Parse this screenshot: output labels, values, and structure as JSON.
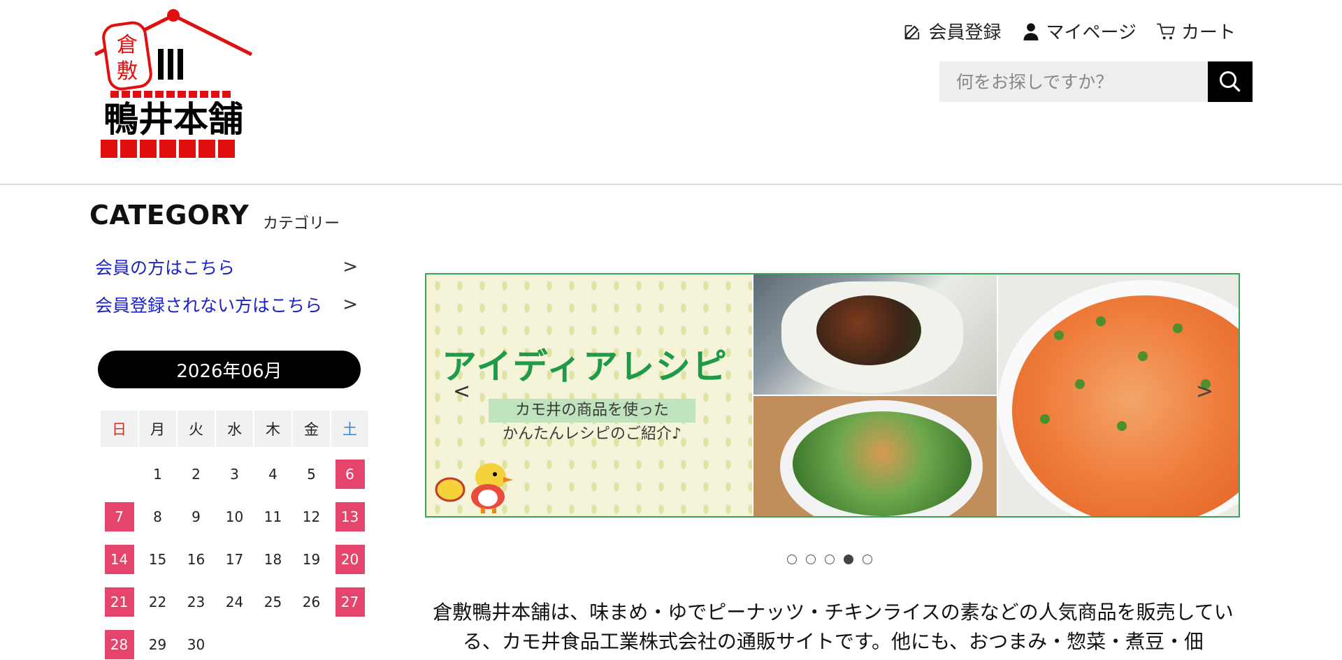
{
  "brand": {
    "logo_text_kura": "倉",
    "logo_text_shiki": "敷",
    "logo_mark": "Ш",
    "logo_name": "鴨井本舗"
  },
  "header": {
    "links": [
      {
        "label": "会員登録",
        "icon": "edit-icon"
      },
      {
        "label": "マイページ",
        "icon": "user-icon"
      },
      {
        "label": "カート",
        "icon": "cart-icon"
      }
    ],
    "search": {
      "placeholder": "何をお探しですか？",
      "value": ""
    }
  },
  "sidebar": {
    "category_title": "CATEGORY",
    "category_sub": "カテゴリー",
    "links": [
      {
        "label": "会員の方はこちら",
        "chevron": ">"
      },
      {
        "label": "会員登録されない方はこちら",
        "chevron": ">"
      }
    ],
    "calendar": {
      "month_label": "2026年06月",
      "weekdays": [
        "日",
        "月",
        "火",
        "水",
        "木",
        "金",
        "土"
      ],
      "weeks": [
        [
          "",
          "1",
          "2",
          "3",
          "4",
          "5",
          "6"
        ],
        [
          "7",
          "8",
          "9",
          "10",
          "11",
          "12",
          "13"
        ],
        [
          "14",
          "15",
          "16",
          "17",
          "18",
          "19",
          "20"
        ],
        [
          "21",
          "22",
          "23",
          "24",
          "25",
          "26",
          "27"
        ],
        [
          "28",
          "29",
          "30",
          "",
          "",
          "",
          ""
        ]
      ],
      "holiday_color": "#e5456c"
    }
  },
  "banner": {
    "title": "アイディアレシピ",
    "caption_line1": "カモ井の商品を使った",
    "caption_line2": "かんたんレシピのご紹介♪",
    "prev": "<",
    "next": ">",
    "slide_count": 5,
    "active_slide": 4,
    "border_color": "#3aa35a",
    "title_color": "#1f9a48"
  },
  "intro_text": "倉敷鴨井本舗は、味まめ・ゆでピーナッツ・チキンライスの素などの人気商品を販売している、カモ井食品工業株式会社の通販サイトです。他にも、おつまみ・惣菜・煮豆・佃"
}
